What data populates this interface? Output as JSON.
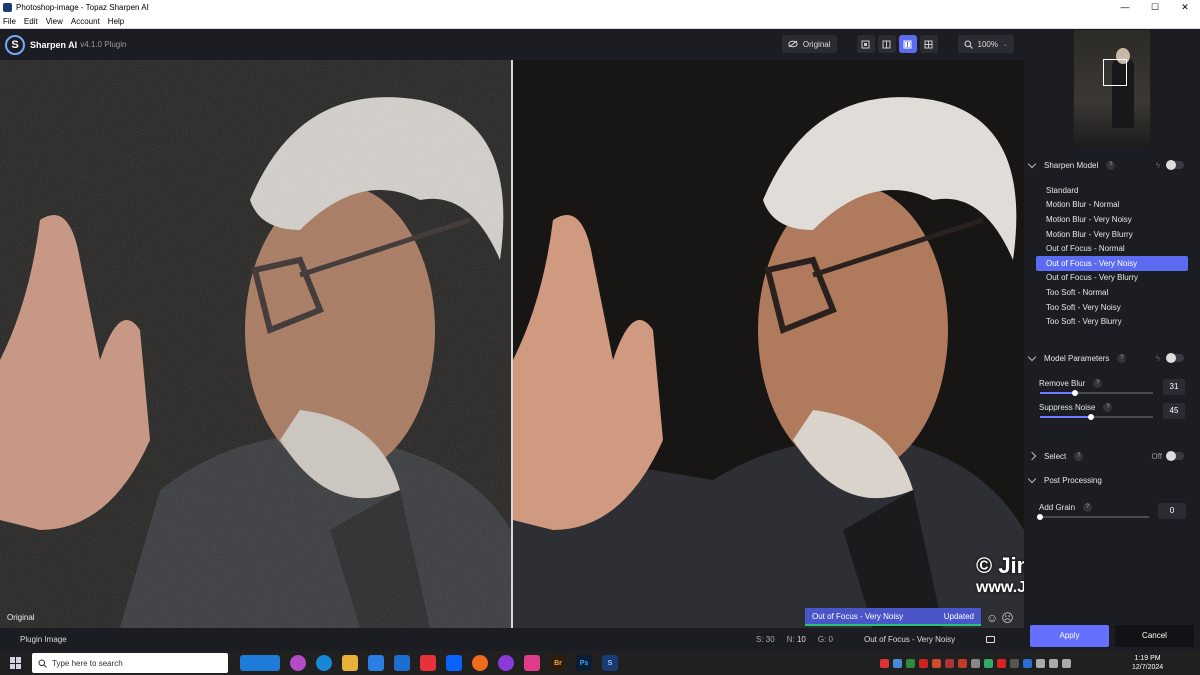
{
  "window": {
    "title": "Photoshop-image - Topaz Sharpen AI",
    "min": "—",
    "max": "☐",
    "close": "✕"
  },
  "menu": [
    "File",
    "Edit",
    "View",
    "Account",
    "Help"
  ],
  "app": {
    "name": "Sharpen AI",
    "version": "v4.1.0 Plugin",
    "logo_letter": "S"
  },
  "toolbar": {
    "original_label": "Original",
    "zoom": "100%"
  },
  "viewer": {
    "left_label": "Original"
  },
  "status_chip": {
    "model": "Out of Focus - Very Noisy",
    "state": "Updated"
  },
  "watermark": {
    "line1": "© Jim Doty, Jr.",
    "line2": "www.JimDoty.com"
  },
  "bottombar": {
    "plugin_label": "Plugin Image",
    "s_label": "S:",
    "s_value": "30",
    "n_label": "N:",
    "n_value": "10",
    "g_label": "G:",
    "g_value": "0",
    "model": "Out of Focus - Very Noisy"
  },
  "sidebar": {
    "sharpen_model": {
      "title": "Sharpen Model",
      "help": "?"
    },
    "models": [
      "Standard",
      "Motion Blur - Normal",
      "Motion Blur - Very Noisy",
      "Motion Blur - Very Blurry",
      "Out of Focus - Normal",
      "Out of Focus - Very Noisy",
      "Out of Focus - Very Blurry",
      "Too Soft - Normal",
      "Too Soft - Very Noisy",
      "Too Soft - Very Blurry"
    ],
    "selected_model_index": 5,
    "model_parameters": {
      "title": "Model Parameters",
      "help": "?"
    },
    "remove_blur": {
      "label": "Remove Blur",
      "value": "31",
      "level": 0.31,
      "help": "?"
    },
    "suppress_noise": {
      "label": "Suppress Noise",
      "value": "45",
      "level": 0.45,
      "help": "?"
    },
    "select": {
      "title": "Select",
      "state": "Off",
      "help": "?"
    },
    "post_processing": {
      "title": "Post Processing"
    },
    "add_grain": {
      "label": "Add Grain",
      "value": "0",
      "level": 0.0,
      "help": "?"
    },
    "apply_label": "Apply",
    "cancel_label": "Cancel"
  },
  "taskbar": {
    "search_placeholder": "Type here to search",
    "apps": [
      "Br",
      "Ps",
      "S"
    ],
    "time": "1:19 PM",
    "date": "12/7/2024"
  },
  "colors": {
    "accent": "#5b6cf2",
    "apply": "#6670ff",
    "updated_bar": "#27c27a"
  }
}
